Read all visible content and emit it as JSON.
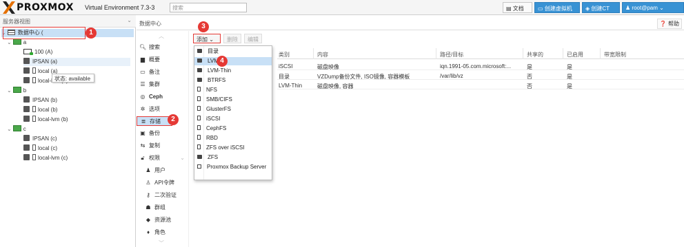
{
  "header": {
    "logo_text": "PROXMOX",
    "product": "Virtual Environment 7.3-3",
    "search_placeholder": "搜索",
    "docs": "文档",
    "create_vm": "创建虚拟机",
    "create_ct": "创建CT",
    "user": "root@pam"
  },
  "tree": {
    "title": "服务器视图",
    "datacenter": "数据中心 (",
    "nodes": [
      {
        "label": "a",
        "children": [
          "100 (A)",
          "IPSAN (a)",
          "local (a)",
          "local-lvm (a)"
        ]
      },
      {
        "label": "b",
        "children": [
          "IPSAN (b)",
          "local (b)",
          "local-lvm (b)"
        ]
      },
      {
        "label": "c",
        "children": [
          "IPSAN (c)",
          "local (c)",
          "local-lvm (c)"
        ]
      }
    ],
    "tooltip": "状态: available"
  },
  "content": {
    "title": "数据中心",
    "help": "帮助"
  },
  "nav": {
    "items": [
      "搜索",
      "概要",
      "备注",
      "集群",
      "Ceph",
      "选项",
      "存储",
      "备份",
      "复制",
      "权限",
      "用户",
      "API令牌",
      "二次验证",
      "群组",
      "资源池",
      "角色"
    ]
  },
  "toolbar": {
    "add": "添加",
    "remove": "删除",
    "edit": "编辑"
  },
  "grid": {
    "columns": [
      "类别",
      "内容",
      "路径/目标",
      "共享的",
      "已启用",
      "带宽限制"
    ],
    "rows": [
      [
        "iSCSI",
        "磁盘映像",
        "iqn.1991-05.com.microsoft:...",
        "是",
        "是",
        ""
      ],
      [
        "目录",
        "VZDump备份文件, ISO镜像, 容器模板",
        "/var/lib/vz",
        "否",
        "是",
        ""
      ],
      [
        "LVM-Thin",
        "磁盘映像, 容器",
        "",
        "否",
        "是",
        ""
      ]
    ]
  },
  "dropdown": {
    "items": [
      "目录",
      "LVM",
      "LVM-Thin",
      "BTRFS",
      "NFS",
      "SMB/CIFS",
      "GlusterFS",
      "iSCSI",
      "CephFS",
      "RBD",
      "ZFS over iSCSI",
      "ZFS",
      "Proxmox Backup Server"
    ]
  },
  "callouts": [
    "1",
    "2",
    "3",
    "4"
  ],
  "colors": {
    "accent": "#3892d4",
    "selection": "#c8e0f6",
    "callout": "#e53935",
    "logo_orange": "#e57000"
  }
}
